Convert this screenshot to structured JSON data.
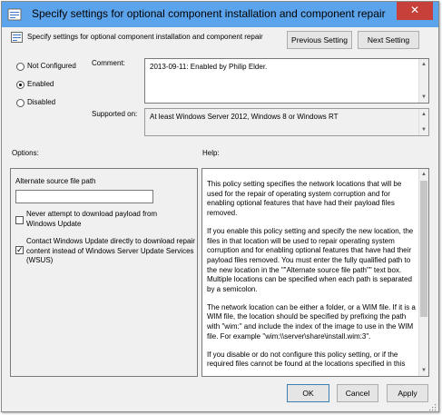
{
  "window": {
    "title": "Specify settings for optional component installation and component repair",
    "close_glyph": "✕"
  },
  "header": {
    "setting_name": "Specify settings for optional component installation and component repair",
    "prev_button": "Previous Setting",
    "next_button": "Next Setting"
  },
  "state": {
    "not_configured": "Not Configured",
    "enabled": "Enabled",
    "disabled": "Disabled",
    "selected": "enabled"
  },
  "comment": {
    "label": "Comment:",
    "value": "2013-09-11: Enabled by Philip Elder."
  },
  "supported": {
    "label": "Supported on:",
    "value": "At least Windows Server 2012, Windows 8 or Windows RT"
  },
  "options": {
    "label": "Options:",
    "alt_source_label": "Alternate source file path",
    "alt_source_value": "",
    "never_download_label": "Never attempt to download payload from Windows Update",
    "never_download_checked": false,
    "contact_wu_label": "Contact Windows Update directly to download repair content instead of Windows Server Update Services (WSUS)",
    "contact_wu_checked": true
  },
  "help": {
    "label": "Help:",
    "paragraphs": [
      "This policy setting specifies the network locations that will be used for the repair of operating system corruption and for enabling optional features that have had their payload files removed.",
      "If you enable this policy setting and specify the new location, the files in that location will be used to repair operating system corruption and for enabling optional features that have had their payload files removed. You must enter the fully qualified path to the new location in the \"\"Alternate source file path\"\" text box. Multiple locations can be specified when each path is separated by a semicolon.",
      "The network location can be either a folder, or a WIM file. If it is a WIM file, the location should be specified by prefixing the path with \"wim:\" and include the index of the image to use in the WIM file. For example \"wim:\\\\server\\share\\install.wim:3\".",
      "If you disable or do not configure this policy setting, or if the required files cannot be found at the locations specified in this"
    ]
  },
  "footer": {
    "ok": "OK",
    "cancel": "Cancel",
    "apply": "Apply"
  },
  "colors": {
    "titlebar": "#5ba4ec",
    "close": "#c7403a",
    "window_bg": "#f0f0f0"
  }
}
